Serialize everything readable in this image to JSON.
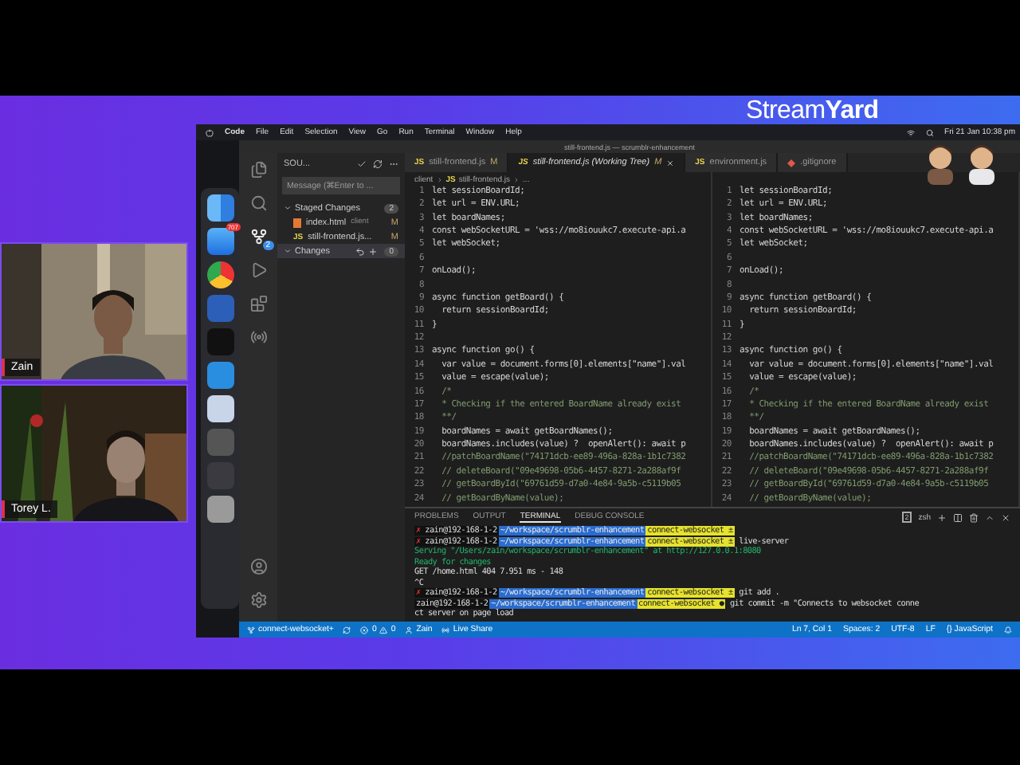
{
  "logo": "Stream**Yard**",
  "cams": [
    {
      "name": "Zain"
    },
    {
      "name": "Torey L."
    }
  ],
  "menubar": {
    "app": "Code",
    "items": [
      "File",
      "Edit",
      "Selection",
      "View",
      "Go",
      "Run",
      "Terminal",
      "Window",
      "Help"
    ],
    "clock": "Fri 21 Jan  10:38 pm"
  },
  "dock": {
    "mail_badge": "707"
  },
  "window": {
    "title": "still-frontend.js — scrumblr-enhancement"
  },
  "activity": {
    "scm_badge": "2"
  },
  "sidebar": {
    "title": "SOU...",
    "message_placeholder": "Message (⌘Enter to ...",
    "groups": [
      {
        "label": "Staged Changes",
        "count": "2",
        "files": [
          {
            "name": "index.html",
            "dir": "client",
            "status": "M",
            "kind": "html"
          },
          {
            "name": "still-frontend.js...",
            "status": "M",
            "kind": "js",
            "icon": "JS"
          }
        ]
      },
      {
        "label": "Changes",
        "count": "0"
      }
    ]
  },
  "tabs": [
    {
      "label": "still-frontend.js",
      "status": "M",
      "italic": false,
      "selected": false,
      "kind": "js",
      "icon": "JS"
    },
    {
      "label": "still-frontend.js (Working Tree)",
      "status": "M",
      "italic": true,
      "selected": true,
      "kind": "js",
      "icon": "JS"
    },
    {
      "label": "environment.js",
      "italic": false,
      "selected": false,
      "kind": "js",
      "icon": "JS"
    },
    {
      "label": ".gitignore",
      "italic": false,
      "selected": false,
      "kind": "git"
    }
  ],
  "breadcrumb": [
    {
      "label": "client"
    },
    {
      "label": "still-frontend.js",
      "icon": "JS"
    },
    {
      "label": "..."
    }
  ],
  "panes": [
    {
      "lines": [
        {
          "n": "1",
          "text": "let sessionBoardId;",
          "kind": "code"
        },
        {
          "n": "2",
          "text": "let url = ENV.URL;",
          "kind": "code"
        },
        {
          "n": "3",
          "text": "let boardNames;",
          "kind": "code"
        },
        {
          "n": "4",
          "text": "const webSocketURL = 'wss://mo8iouukc7.execute-api.a",
          "kind": "code"
        },
        {
          "n": "5",
          "text": "let webSocket;",
          "kind": "code"
        },
        {
          "n": "6"
        },
        {
          "n": "7",
          "text": "onLoad();",
          "kind": "code"
        },
        {
          "n": "8"
        },
        {
          "n": "9",
          "text": "async function getBoard() {",
          "kind": "code"
        },
        {
          "n": "10",
          "text": "  return sessionBoardId;",
          "kind": "code"
        },
        {
          "n": "11",
          "text": "}",
          "kind": "code"
        },
        {
          "n": "12"
        },
        {
          "n": "13",
          "text": "async function go() {",
          "kind": "code"
        },
        {
          "n": "14",
          "text": "  var value = document.forms[0].elements[\"name\"].val",
          "kind": "code"
        },
        {
          "n": "15",
          "text": "  value = escape(value);",
          "kind": "code"
        },
        {
          "n": "16",
          "text": "  /*",
          "kind": "comment"
        },
        {
          "n": "17",
          "text": "  * Checking if the entered BoardName already exist",
          "kind": "comment"
        },
        {
          "n": "18",
          "text": "  **/",
          "kind": "comment"
        },
        {
          "n": "19",
          "text": "  boardNames = await getBoardNames();",
          "kind": "code"
        },
        {
          "n": "20",
          "text": "  boardNames.includes(value) ?  openAlert(): await p",
          "kind": "code"
        },
        {
          "n": "21",
          "text": "  //patchBoardName(\"74171dcb-ee89-496a-828a-1b1c7382",
          "kind": "comment"
        },
        {
          "n": "22",
          "text": "  // deleteBoard(\"09e49698-05b6-4457-8271-2a288af9f",
          "kind": "comment"
        },
        {
          "n": "23",
          "text": "  // getBoardById(\"69761d59-d7a0-4e84-9a5b-c5119b05",
          "kind": "comment"
        },
        {
          "n": "24",
          "text": "  // getBoardByName(value);",
          "kind": "comment"
        }
      ]
    },
    {
      "lines": [
        {
          "n": "1",
          "text": "let sessionBoardId;",
          "kind": "code"
        },
        {
          "n": "2",
          "text": "let url = ENV.URL;",
          "kind": "code"
        },
        {
          "n": "3",
          "text": "let boardNames;",
          "kind": "code"
        },
        {
          "n": "4",
          "text": "const webSocketURL = 'wss://mo8iouukc7.execute-api.a",
          "kind": "code"
        },
        {
          "n": "5",
          "text": "let webSocket;",
          "kind": "code"
        },
        {
          "n": "6"
        },
        {
          "n": "7",
          "text": "onLoad();",
          "kind": "code"
        },
        {
          "n": "8"
        },
        {
          "n": "9",
          "text": "async function getBoard() {",
          "kind": "code"
        },
        {
          "n": "10",
          "text": "  return sessionBoardId;",
          "kind": "code"
        },
        {
          "n": "11",
          "text": "}",
          "kind": "code"
        },
        {
          "n": "12"
        },
        {
          "n": "13",
          "text": "async function go() {",
          "kind": "code"
        },
        {
          "n": "14",
          "text": "  var value = document.forms[0].elements[\"name\"].val",
          "kind": "code"
        },
        {
          "n": "15",
          "text": "  value = escape(value);",
          "kind": "code"
        },
        {
          "n": "16",
          "text": "  /*",
          "kind": "comment"
        },
        {
          "n": "17",
          "text": "  * Checking if the entered BoardName already exist",
          "kind": "comment"
        },
        {
          "n": "18",
          "text": "  **/",
          "kind": "comment"
        },
        {
          "n": "19",
          "text": "  boardNames = await getBoardNames();",
          "kind": "code"
        },
        {
          "n": "20",
          "text": "  boardNames.includes(value) ?  openAlert(): await p",
          "kind": "code"
        },
        {
          "n": "21",
          "text": "  //patchBoardName(\"74171dcb-ee89-496a-828a-1b1c7382",
          "kind": "comment"
        },
        {
          "n": "22",
          "text": "  // deleteBoard(\"09e49698-05b6-4457-8271-2a288af9f",
          "kind": "comment"
        },
        {
          "n": "23",
          "text": "  // getBoardById(\"69761d59-d7a0-4e84-9a5b-c5119b05",
          "kind": "comment"
        },
        {
          "n": "24",
          "text": "  // getBoardByName(value);",
          "kind": "comment"
        }
      ]
    }
  ],
  "panel": {
    "tabs": [
      {
        "label": "PROBLEMS",
        "selected": false
      },
      {
        "label": "OUTPUT",
        "selected": false
      },
      {
        "label": "TERMINAL",
        "selected": true
      },
      {
        "label": "DEBUG CONSOLE",
        "selected": false
      }
    ],
    "shell_count": "2",
    "shell": "zsh"
  },
  "terminal": [
    {
      "kind": "prompt",
      "mark": "✗",
      "user": "zain@192-168-1-2",
      "path": "~/workspace/scrumblr-enhancement",
      "branch": "connect-websocket ±"
    },
    {
      "kind": "prompt",
      "mark": "✗",
      "user": "zain@192-168-1-2",
      "path": "~/workspace/scrumblr-enhancement",
      "branch": "connect-websocket ±",
      "cmd": "live-server"
    },
    {
      "kind": "info",
      "text": "Serving \"/Users/zain/workspace/scrumblr-enhancement\" at http://127.0.0.1:8080"
    },
    {
      "kind": "info",
      "text": "Ready for changes"
    },
    {
      "kind": "plain",
      "text": "GET /home.html 404 7.951 ms - 148"
    },
    {
      "kind": "plain",
      "text": "^C"
    },
    {
      "kind": "prompt",
      "mark": "✗",
      "user": "zain@192-168-1-2",
      "path": "~/workspace/scrumblr-enhancement",
      "branch": "connect-websocket ±",
      "cmd": "git add ."
    },
    {
      "kind": "prompt",
      "user": "zain@192-168-1-2",
      "path": "~/workspace/scrumblr-enhancement",
      "branch": "connect-websocket ●",
      "cmd": "git commit -m \"Connects to websocket conne"
    },
    {
      "kind": "plain",
      "text": "ct server on page load"
    }
  ],
  "status": {
    "branch": "connect-websocket+",
    "errors": "0",
    "warnings": "0",
    "user": "Zain",
    "live_share": "Live Share",
    "right": [
      "Ln 7, Col 1",
      "Spaces: 2",
      "UTF-8",
      "LF",
      "{} JavaScript"
    ]
  }
}
